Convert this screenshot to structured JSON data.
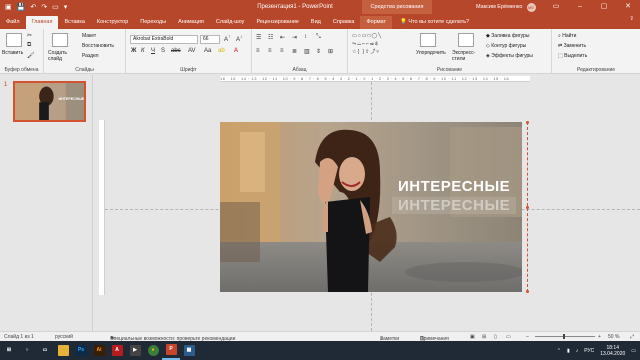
{
  "window": {
    "title": "Презентация1 - PowerPoint",
    "context_title": "Средства рисования",
    "user": "Максим Ерёменко",
    "user_initials": "МЕ"
  },
  "tabs": [
    "Файл",
    "Главная",
    "Вставка",
    "Конструктор",
    "Переходы",
    "Анимация",
    "Слайд-шоу",
    "Рецензирование",
    "Вид",
    "Справка",
    "Формат"
  ],
  "active_tab": "Главная",
  "tell_me": "Что вы хотите сделать?",
  "ribbon": {
    "clipboard": {
      "label": "Буфер обмена",
      "paste": "Вставить"
    },
    "slides": {
      "label": "Слайды",
      "new_slide": "Создать слайд",
      "layout": "Макет",
      "reset": "Восстановить",
      "section": "Раздел"
    },
    "font": {
      "label": "Шрифт",
      "font_name": "Akrobat ExtraBold",
      "font_size": "66"
    },
    "paragraph": {
      "label": "Абзац"
    },
    "drawing": {
      "label": "Рисование",
      "arrange": "Упорядочить",
      "quick_styles": "Экспресс-стили",
      "fill": "Заливка фигуры",
      "outline": "Контур фигуры",
      "effects": "Эффекты фигуры"
    },
    "editing": {
      "label": "Редактирование",
      "find": "Найти",
      "replace": "Заменить",
      "select": "Выделить"
    }
  },
  "ruler_text": "16 · 15 · 14 · 13 · 12 · 11 · 10 · 9 · 8 · 7 · 6 · 5 · 4 · 3 · 2 · 1 · 0 · 1 · 2 · 3 · 4 · 5 · 6 · 7 · 8 · 9 · 10 · 11 · 12 · 13 · 14 · 15 · 16",
  "slide_pane": {
    "slide_number": "1"
  },
  "slide": {
    "heading": "ИНТЕРЕСНЫЕ",
    "heading_reflection": "ИНТЕРЕСНЫЕ"
  },
  "status": {
    "slide_info": "Слайд 1 из 1",
    "language": "русский",
    "accessibility": "Специальные возможности: проверьте рекомендации",
    "notes": "Заметки",
    "comments": "Примечания",
    "zoom": "50 %"
  },
  "taskbar": {
    "apps": [
      {
        "name": "windows",
        "glyph": "⊞",
        "color": "#1f2a36"
      },
      {
        "name": "search",
        "glyph": "○",
        "color": "#1f2a36"
      },
      {
        "name": "taskview",
        "glyph": "▭",
        "color": "#1f2a36"
      },
      {
        "name": "explorer",
        "glyph": "▬",
        "color": "#e8b13a"
      },
      {
        "name": "photoshop",
        "glyph": "Ps",
        "color": "#0c2b48"
      },
      {
        "name": "illustrator",
        "glyph": "Ai",
        "color": "#3a1d05"
      },
      {
        "name": "acrobat",
        "glyph": "A",
        "color": "#b71c1c"
      },
      {
        "name": "media",
        "glyph": "▶",
        "color": "#444444"
      },
      {
        "name": "chrome",
        "glyph": "●",
        "color": "#3b7d3b"
      },
      {
        "name": "powerpoint",
        "glyph": "P",
        "color": "#c5462a"
      },
      {
        "name": "gallery",
        "glyph": "▦",
        "color": "#2a5d8a"
      }
    ],
    "lang": "РУС",
    "time": "18:14",
    "date": "13.04.2020"
  }
}
